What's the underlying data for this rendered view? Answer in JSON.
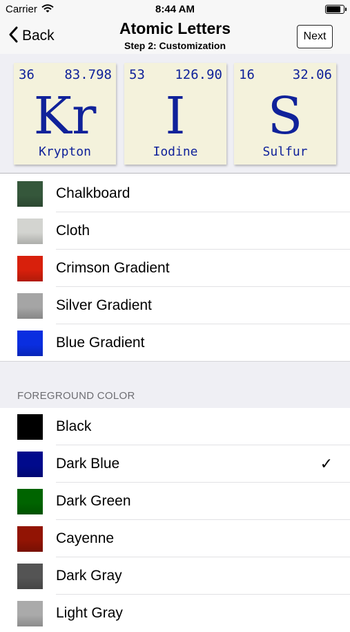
{
  "status_bar": {
    "carrier": "Carrier",
    "time": "8:44 AM",
    "battery_level": 0.9
  },
  "nav": {
    "back_label": "Back",
    "title": "Atomic Letters",
    "subtitle": "Step 2: Customization",
    "next_label": "Next"
  },
  "tiles": [
    {
      "number": "36",
      "mass": "83.798",
      "symbol": "Kr",
      "name": "Krypton"
    },
    {
      "number": "53",
      "mass": "126.90",
      "symbol": "I",
      "name": "Iodine"
    },
    {
      "number": "16",
      "mass": "32.06",
      "symbol": "S",
      "name": "Sulfur"
    }
  ],
  "background_options": [
    {
      "label": "Chalkboard",
      "color": "#35573b"
    },
    {
      "label": "Cloth",
      "color": "#d3d4d0"
    },
    {
      "label": "Crimson Gradient",
      "color": "#d8200c"
    },
    {
      "label": "Silver Gradient",
      "color": "#a5a5a5"
    },
    {
      "label": "Blue Gradient",
      "color": "#0a2ee0"
    }
  ],
  "foreground_section": {
    "header": "FOREGROUND COLOR",
    "options": [
      {
        "label": "Black",
        "color": "#000000",
        "selected": false
      },
      {
        "label": "Dark Blue",
        "color": "#000a8c",
        "selected": true
      },
      {
        "label": "Dark Green",
        "color": "#006400",
        "selected": false
      },
      {
        "label": "Cayenne",
        "color": "#921404",
        "selected": false
      },
      {
        "label": "Dark Gray",
        "color": "#545454",
        "selected": false
      },
      {
        "label": "Light Gray",
        "color": "#aaaaaa",
        "selected": false
      }
    ],
    "check_mark": "✓"
  }
}
